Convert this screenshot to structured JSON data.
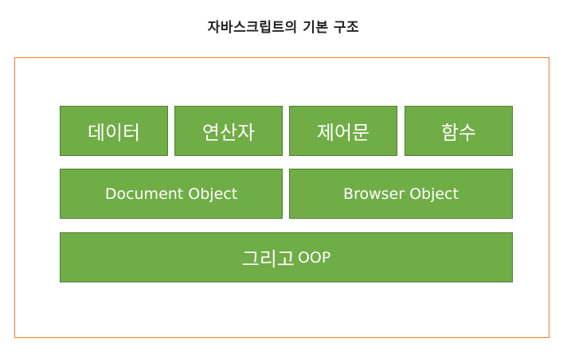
{
  "title": "자바스크립트의 기본 구조",
  "blocks": {
    "row1": [
      "데이터",
      "연산자",
      "제어문",
      "함수"
    ],
    "row2": [
      "Document Object",
      "Browser Object"
    ],
    "row3": {
      "text": "그리고",
      "suffix": "OOP"
    }
  },
  "colors": {
    "box_fill": "#70ad47",
    "box_border": "#507e32",
    "frame_border": "#ed7d31",
    "box_text": "#ffffff"
  }
}
